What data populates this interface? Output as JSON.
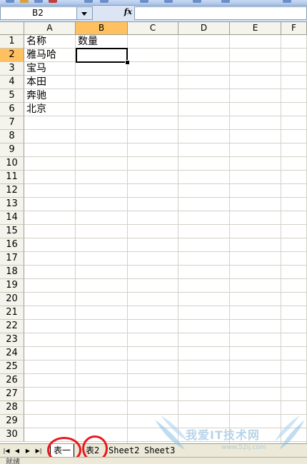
{
  "formula_bar": {
    "name_box": "B2",
    "fx_label": "fx",
    "formula": ""
  },
  "columns": [
    "A",
    "B",
    "C",
    "D",
    "E",
    "F"
  ],
  "selected_column": "B",
  "rows": [
    "1",
    "2",
    "3",
    "4",
    "5",
    "6",
    "7",
    "8",
    "9",
    "10",
    "11",
    "12",
    "13",
    "14",
    "15",
    "16",
    "17",
    "18",
    "19",
    "20",
    "21",
    "22",
    "23",
    "24",
    "25",
    "26",
    "27",
    "28",
    "29",
    "30"
  ],
  "selected_row": "2",
  "cells": {
    "A1": "名称",
    "B1": "数量",
    "A2": "雅马哈",
    "A3": "宝马",
    "A4": "本田",
    "A5": "奔驰",
    "A6": "北京"
  },
  "sheet_tabs": [
    "表一",
    "表2",
    "Sheet2",
    "Sheet3"
  ],
  "active_tab": "表一",
  "nav_buttons": [
    "|◀",
    "◀",
    "▶",
    "▶|"
  ],
  "status": "就绪",
  "watermark": {
    "text": "我爱IT技术网",
    "url": "www.52ij.com"
  },
  "colors": {
    "selected_header": "#ffc060",
    "annotation_circle": "#e8191e"
  }
}
